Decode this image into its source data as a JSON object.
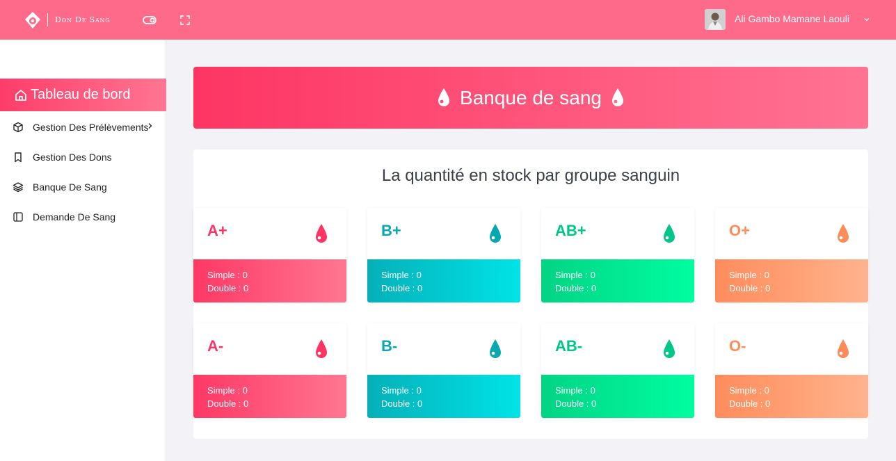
{
  "app": {
    "brand": "Don De Sang",
    "user_name": "Ali Gambo Mamane Laouli"
  },
  "colors": {
    "topbar": "#fe6a8a",
    "accent_red": "#fe3563",
    "accent_teal": "#08a8b0",
    "accent_green": "#00c68a",
    "accent_orange": "#fe8c58"
  },
  "icons": {
    "logo": "blood-drop-logo-icon",
    "toggle": "toggle-icon",
    "fullscreen": "fullscreen-icon",
    "user_menu": "chevron-down-icon"
  },
  "sidebar": {
    "active": {
      "label": "Tableau de bord",
      "icon": "home-icon"
    },
    "items": [
      {
        "label": "Gestion Des Prélèvements",
        "icon": "box-icon"
      },
      {
        "label": "Gestion Des Dons",
        "icon": "bookmark-icon"
      },
      {
        "label": "Banque De Sang",
        "icon": "layers-icon"
      },
      {
        "label": "Demande De Sang",
        "icon": "sidebar-icon"
      }
    ]
  },
  "banner": {
    "title": "Banque de sang"
  },
  "stock": {
    "title": "La quantité en stock par groupe sanguin",
    "groups": [
      {
        "name": "A+",
        "simple": "Simple : 0",
        "double": "Double : 0"
      },
      {
        "name": "B+",
        "simple": "Simple : 0",
        "double": "Double : 0"
      },
      {
        "name": "AB+",
        "simple": "Simple : 0",
        "double": "Double : 0"
      },
      {
        "name": "O+",
        "simple": "Simple : 0",
        "double": "Double : 0"
      },
      {
        "name": "A-",
        "simple": "Simple : 0",
        "double": "Double : 0"
      },
      {
        "name": "B-",
        "simple": "Simple : 0",
        "double": "Double : 0"
      },
      {
        "name": "AB-",
        "simple": "Simple : 0",
        "double": "Double : 0"
      },
      {
        "name": "O-",
        "simple": "Simple : 0",
        "double": "Double : 0"
      }
    ]
  }
}
